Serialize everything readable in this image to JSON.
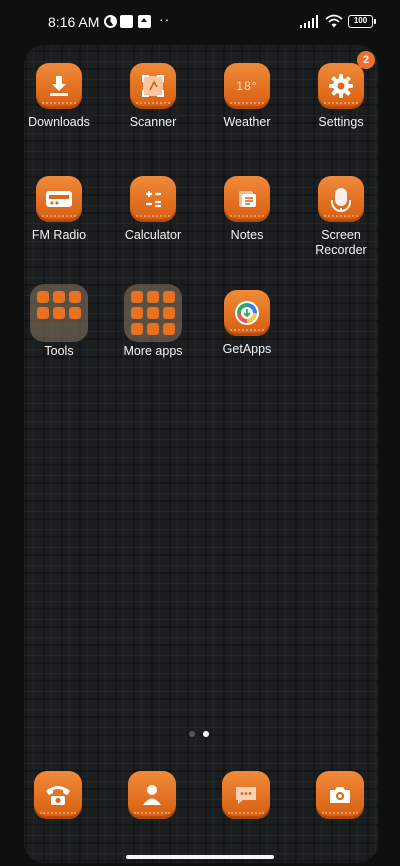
{
  "status_bar": {
    "time": "8:16 AM",
    "overflow": "··",
    "battery": "100"
  },
  "badge": {
    "settings_count": "2"
  },
  "apps": {
    "downloads": "Downloads",
    "scanner": "Scanner",
    "weather": "Weather",
    "weather_temp": "18°",
    "settings": "Settings",
    "fm_radio": "FM Radio",
    "calculator": "Calculator",
    "notes": "Notes",
    "screen_recorder": "Screen\nRecorder",
    "tools": "Tools",
    "more_apps": "More apps",
    "getapps": "GetApps"
  },
  "page_indicator": {
    "pages": 2,
    "current": 2
  },
  "dock": [
    "Phone",
    "Contacts",
    "Messaging",
    "Camera"
  ],
  "colors": {
    "accent": "#e7711e",
    "background": "#1a1e1f"
  },
  "icons": {
    "downloads": "download-icon",
    "scanner": "scanner-icon",
    "weather": "weather-icon",
    "settings": "gear-icon",
    "fm_radio": "radio-icon",
    "calculator": "calculator-icon",
    "notes": "notes-icon",
    "screen_recorder": "screen-recorder-icon",
    "getapps": "getapps-icon"
  }
}
